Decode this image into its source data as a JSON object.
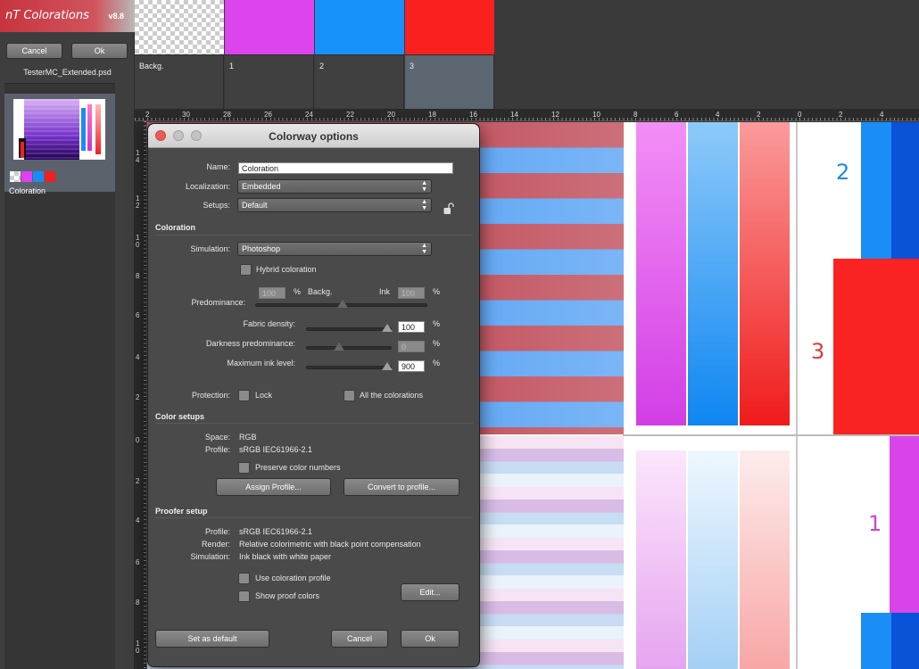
{
  "app": {
    "name": "nT Colorations",
    "version": "v8.8"
  },
  "left_panel": {
    "cancel_label": "Cancel",
    "ok_label": "Ok",
    "file_name": "TesterMC_Extended.psd",
    "coloration_name": "Coloration",
    "swatch_colors": [
      "checker",
      "#e040f0",
      "#1a8cf5",
      "#f02020"
    ]
  },
  "channels": [
    {
      "label": "Backg.",
      "color": "checker",
      "selected": false
    },
    {
      "label": "1",
      "color": "#dd44ee",
      "selected": false
    },
    {
      "label": "2",
      "color": "#1792fa",
      "selected": false
    },
    {
      "label": "3",
      "color": "#fa2020",
      "selected": true
    }
  ],
  "ruler": {
    "h_labels": [
      "2",
      "30",
      "28",
      "26",
      "24",
      "22",
      "20",
      "18",
      "16",
      "14",
      "12",
      "10",
      "8",
      "6",
      "4",
      "2",
      "0",
      "2",
      "4"
    ],
    "v_labels": [
      "14",
      "12",
      "10",
      "8",
      "6",
      "4",
      "2",
      "0",
      "2",
      "4",
      "6",
      "8",
      "10"
    ]
  },
  "canvas": {
    "labels": [
      "2",
      "3",
      "1"
    ],
    "label_colors": [
      "#1a8ce0",
      "#e03a3a",
      "#cc44dd"
    ]
  },
  "dialog": {
    "title": "Colorway options",
    "name_label": "Name:",
    "name_value": "Coloration",
    "localization_label": "Localization:",
    "localization_value": "Embedded",
    "setups_label": "Setups:",
    "setups_value": "Default",
    "coloration_section": "Coloration",
    "simulation_label": "Simulation:",
    "simulation_value": "Photoshop",
    "hybrid_label": "Hybrid coloration",
    "predominance_label": "Predominance:",
    "predominance_left_value": "100",
    "percent": "%",
    "backg_label": "Backg.",
    "ink_label": "Ink",
    "predominance_right_value": "100",
    "fabric_density_label": "Fabric density:",
    "fabric_density_value": "100",
    "darkness_label": "Darkness predominance:",
    "darkness_value": "0",
    "max_ink_label": "Maximum ink level:",
    "max_ink_value": "900",
    "protection_label": "Protection:",
    "lock_label": "Lock",
    "all_colorations_label": "All the colorations",
    "color_setups_section": "Color setups",
    "space_label": "Space:",
    "space_value": "RGB",
    "profile_label": "Profile:",
    "profile_value": "sRGB IEC61966-2.1",
    "preserve_label": "Preserve color numbers",
    "assign_profile_label": "Assign Profile...",
    "convert_profile_label": "Convert to profile...",
    "proofer_section": "Proofer setup",
    "proof_profile_label": "Profile:",
    "proof_profile_value": "sRGB IEC61966-2.1",
    "render_label": "Render:",
    "render_value": "Relative colorimetric with black point compensation",
    "proof_simulation_label": "Simulation:",
    "proof_simulation_value": "Ink black with white paper",
    "use_coloration_profile_label": "Use coloration profile",
    "show_proof_colors_label": "Show proof colors",
    "edit_label": "Edit...",
    "set_default_label": "Set as default",
    "cancel_label": "Cancel",
    "ok_label": "Ok"
  }
}
